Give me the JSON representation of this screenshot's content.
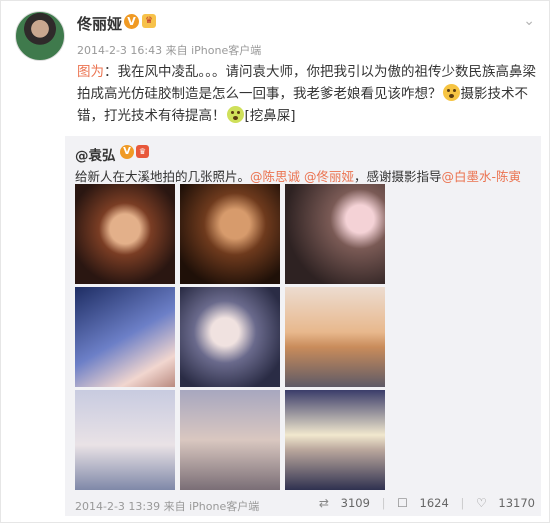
{
  "post": {
    "author": "佟丽娅",
    "meta": "2014-2-3 16:43 来自 iPhone客户端",
    "text_mention": "图为",
    "text_part1": "：我在风中凌乱。。。请问袁大师，你把我引以为傲的祖传少数民族高鼻梁拍成高光仿硅胶制造是怎么一回事，我老爹老娘看见该咋想？",
    "text_part2": "摄影技术不错，打光技术有待提高！",
    "text_part3": "[挖鼻屎]"
  },
  "repost": {
    "author": "@袁弘",
    "text_prefix": "给新人在大溪地拍的几张照片。",
    "mention1": "@陈思诚",
    "mention2": "@佟丽娅",
    "text_mid": "，感谢摄影指导",
    "mention3": "@白墨水-陈寅",
    "time": "2014-2-3 13:39 来自 iPhone客户端",
    "reposts": "3109",
    "comments": "1624",
    "likes": "13170"
  },
  "icons": {
    "verified": "V",
    "vip": "vip-badge",
    "chevron": "chevron-down-icon",
    "repost": "repost-icon",
    "comment": "comment-icon",
    "like": "like-icon"
  }
}
